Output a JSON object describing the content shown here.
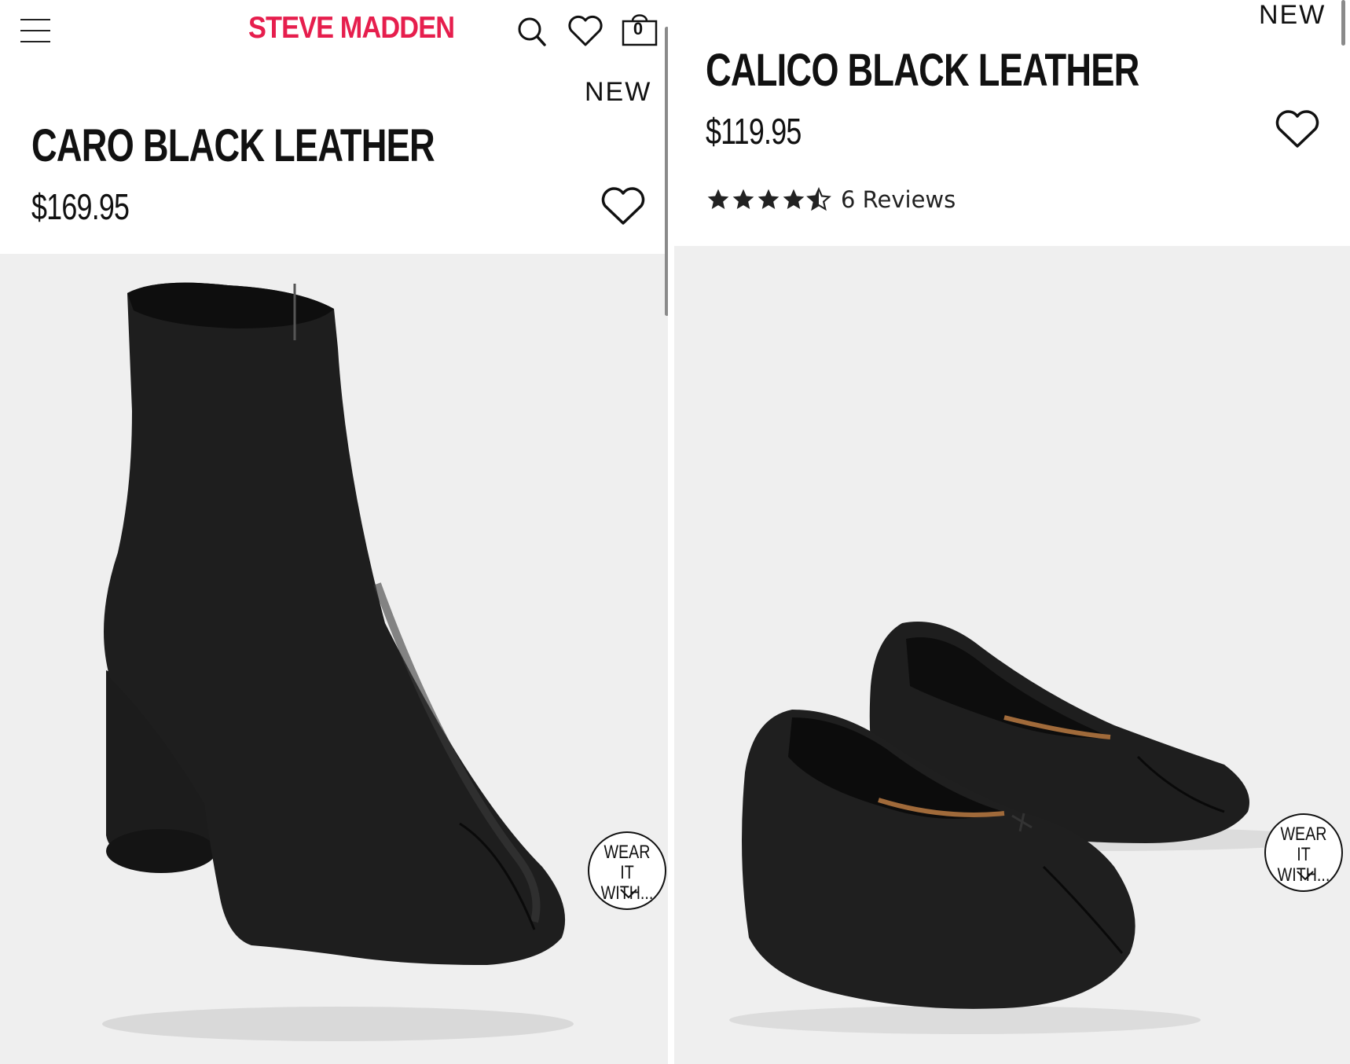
{
  "header": {
    "brand": "STEVE MADDEN",
    "cart_count": "0"
  },
  "products": [
    {
      "badge": "NEW",
      "title": "CARO BLACK LEATHER",
      "price": "$169.95",
      "image_alt": "Black leather split-toe ankle boot with cylindrical heel",
      "wear_it_label_1": "WEAR IT",
      "wear_it_label_2": "WITH..."
    },
    {
      "badge": "NEW",
      "title": "CALICO BLACK LEATHER",
      "price": "$119.95",
      "rating": 4.5,
      "reviews_label": "6 Reviews",
      "image_alt": "Pair of black leather split-toe ballet flats with bow",
      "wear_it_label_1": "WEAR IT",
      "wear_it_label_2": "WITH..."
    }
  ],
  "icons": {
    "menu": "hamburger-menu-icon",
    "search": "search-icon",
    "wishlist": "heart-icon",
    "cart": "shopping-bag-icon",
    "star": "star-icon",
    "chevron": "chevron-down-icon"
  },
  "colors": {
    "brand": "#e61e4d",
    "image_background": "#efefef",
    "text": "#111111"
  }
}
